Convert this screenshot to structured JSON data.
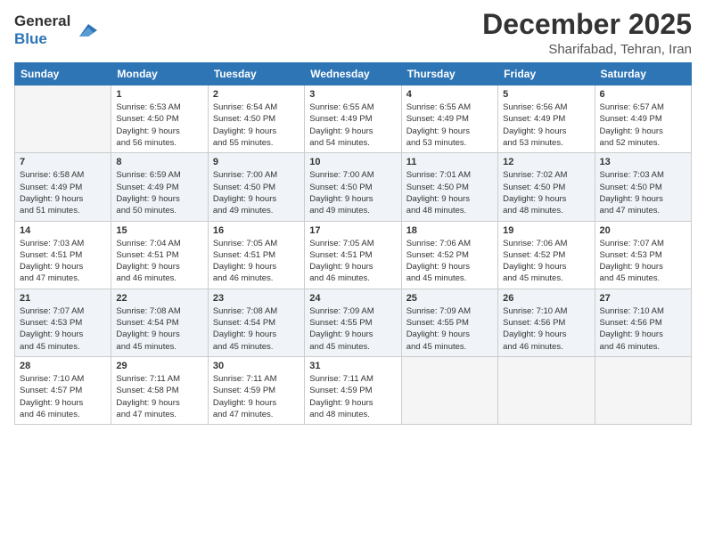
{
  "header": {
    "logo_line1": "General",
    "logo_line2": "Blue",
    "month_title": "December 2025",
    "location": "Sharifabad, Tehran, Iran"
  },
  "weekdays": [
    "Sunday",
    "Monday",
    "Tuesday",
    "Wednesday",
    "Thursday",
    "Friday",
    "Saturday"
  ],
  "weeks": [
    [
      {
        "day": "",
        "info": ""
      },
      {
        "day": "1",
        "info": "Sunrise: 6:53 AM\nSunset: 4:50 PM\nDaylight: 9 hours\nand 56 minutes."
      },
      {
        "day": "2",
        "info": "Sunrise: 6:54 AM\nSunset: 4:50 PM\nDaylight: 9 hours\nand 55 minutes."
      },
      {
        "day": "3",
        "info": "Sunrise: 6:55 AM\nSunset: 4:49 PM\nDaylight: 9 hours\nand 54 minutes."
      },
      {
        "day": "4",
        "info": "Sunrise: 6:55 AM\nSunset: 4:49 PM\nDaylight: 9 hours\nand 53 minutes."
      },
      {
        "day": "5",
        "info": "Sunrise: 6:56 AM\nSunset: 4:49 PM\nDaylight: 9 hours\nand 53 minutes."
      },
      {
        "day": "6",
        "info": "Sunrise: 6:57 AM\nSunset: 4:49 PM\nDaylight: 9 hours\nand 52 minutes."
      }
    ],
    [
      {
        "day": "7",
        "info": "Sunrise: 6:58 AM\nSunset: 4:49 PM\nDaylight: 9 hours\nand 51 minutes."
      },
      {
        "day": "8",
        "info": "Sunrise: 6:59 AM\nSunset: 4:49 PM\nDaylight: 9 hours\nand 50 minutes."
      },
      {
        "day": "9",
        "info": "Sunrise: 7:00 AM\nSunset: 4:50 PM\nDaylight: 9 hours\nand 49 minutes."
      },
      {
        "day": "10",
        "info": "Sunrise: 7:00 AM\nSunset: 4:50 PM\nDaylight: 9 hours\nand 49 minutes."
      },
      {
        "day": "11",
        "info": "Sunrise: 7:01 AM\nSunset: 4:50 PM\nDaylight: 9 hours\nand 48 minutes."
      },
      {
        "day": "12",
        "info": "Sunrise: 7:02 AM\nSunset: 4:50 PM\nDaylight: 9 hours\nand 48 minutes."
      },
      {
        "day": "13",
        "info": "Sunrise: 7:03 AM\nSunset: 4:50 PM\nDaylight: 9 hours\nand 47 minutes."
      }
    ],
    [
      {
        "day": "14",
        "info": "Sunrise: 7:03 AM\nSunset: 4:51 PM\nDaylight: 9 hours\nand 47 minutes."
      },
      {
        "day": "15",
        "info": "Sunrise: 7:04 AM\nSunset: 4:51 PM\nDaylight: 9 hours\nand 46 minutes."
      },
      {
        "day": "16",
        "info": "Sunrise: 7:05 AM\nSunset: 4:51 PM\nDaylight: 9 hours\nand 46 minutes."
      },
      {
        "day": "17",
        "info": "Sunrise: 7:05 AM\nSunset: 4:51 PM\nDaylight: 9 hours\nand 46 minutes."
      },
      {
        "day": "18",
        "info": "Sunrise: 7:06 AM\nSunset: 4:52 PM\nDaylight: 9 hours\nand 45 minutes."
      },
      {
        "day": "19",
        "info": "Sunrise: 7:06 AM\nSunset: 4:52 PM\nDaylight: 9 hours\nand 45 minutes."
      },
      {
        "day": "20",
        "info": "Sunrise: 7:07 AM\nSunset: 4:53 PM\nDaylight: 9 hours\nand 45 minutes."
      }
    ],
    [
      {
        "day": "21",
        "info": "Sunrise: 7:07 AM\nSunset: 4:53 PM\nDaylight: 9 hours\nand 45 minutes."
      },
      {
        "day": "22",
        "info": "Sunrise: 7:08 AM\nSunset: 4:54 PM\nDaylight: 9 hours\nand 45 minutes."
      },
      {
        "day": "23",
        "info": "Sunrise: 7:08 AM\nSunset: 4:54 PM\nDaylight: 9 hours\nand 45 minutes."
      },
      {
        "day": "24",
        "info": "Sunrise: 7:09 AM\nSunset: 4:55 PM\nDaylight: 9 hours\nand 45 minutes."
      },
      {
        "day": "25",
        "info": "Sunrise: 7:09 AM\nSunset: 4:55 PM\nDaylight: 9 hours\nand 45 minutes."
      },
      {
        "day": "26",
        "info": "Sunrise: 7:10 AM\nSunset: 4:56 PM\nDaylight: 9 hours\nand 46 minutes."
      },
      {
        "day": "27",
        "info": "Sunrise: 7:10 AM\nSunset: 4:56 PM\nDaylight: 9 hours\nand 46 minutes."
      }
    ],
    [
      {
        "day": "28",
        "info": "Sunrise: 7:10 AM\nSunset: 4:57 PM\nDaylight: 9 hours\nand 46 minutes."
      },
      {
        "day": "29",
        "info": "Sunrise: 7:11 AM\nSunset: 4:58 PM\nDaylight: 9 hours\nand 47 minutes."
      },
      {
        "day": "30",
        "info": "Sunrise: 7:11 AM\nSunset: 4:59 PM\nDaylight: 9 hours\nand 47 minutes."
      },
      {
        "day": "31",
        "info": "Sunrise: 7:11 AM\nSunset: 4:59 PM\nDaylight: 9 hours\nand 48 minutes."
      },
      {
        "day": "",
        "info": ""
      },
      {
        "day": "",
        "info": ""
      },
      {
        "day": "",
        "info": ""
      }
    ]
  ]
}
